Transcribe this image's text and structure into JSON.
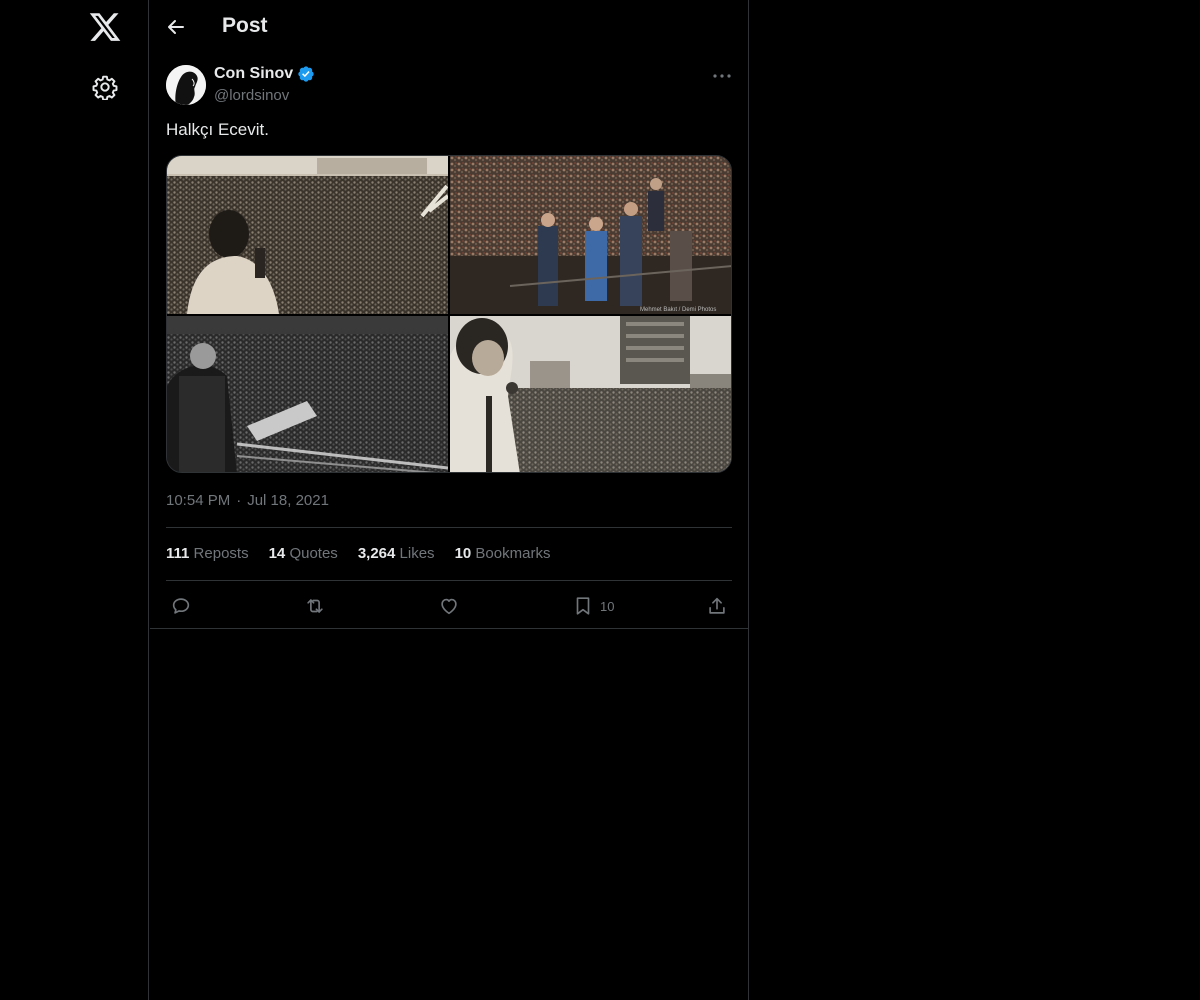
{
  "header": {
    "title": "Post"
  },
  "author": {
    "display_name": "Con Sinov",
    "handle": "@lordsinov",
    "verified": true
  },
  "post": {
    "text": "Halkçı Ecevit.",
    "time": "10:54 PM",
    "separator": "·",
    "date": "Jul 18, 2021",
    "image_count": 4
  },
  "stats": {
    "reposts_count": "111",
    "reposts_label": "Reposts",
    "quotes_count": "14",
    "quotes_label": "Quotes",
    "likes_count": "3,264",
    "likes_label": "Likes",
    "bookmarks_count": "10",
    "bookmarks_label": "Bookmarks"
  },
  "actions": {
    "bookmark_count": "10"
  },
  "icons": {
    "logo": "x-logo-icon",
    "settings": "gear-icon",
    "back": "arrow-left-icon",
    "verified": "verified-badge-icon",
    "more": "more-horizontal-icon",
    "reply": "reply-icon",
    "repost": "repost-icon",
    "like": "heart-icon",
    "bookmark": "bookmark-icon",
    "share": "share-icon"
  },
  "colors": {
    "background": "#000000",
    "text": "#e7e9ea",
    "muted": "#71767b",
    "border": "#2f3336",
    "verified": "#1d9bf0"
  }
}
